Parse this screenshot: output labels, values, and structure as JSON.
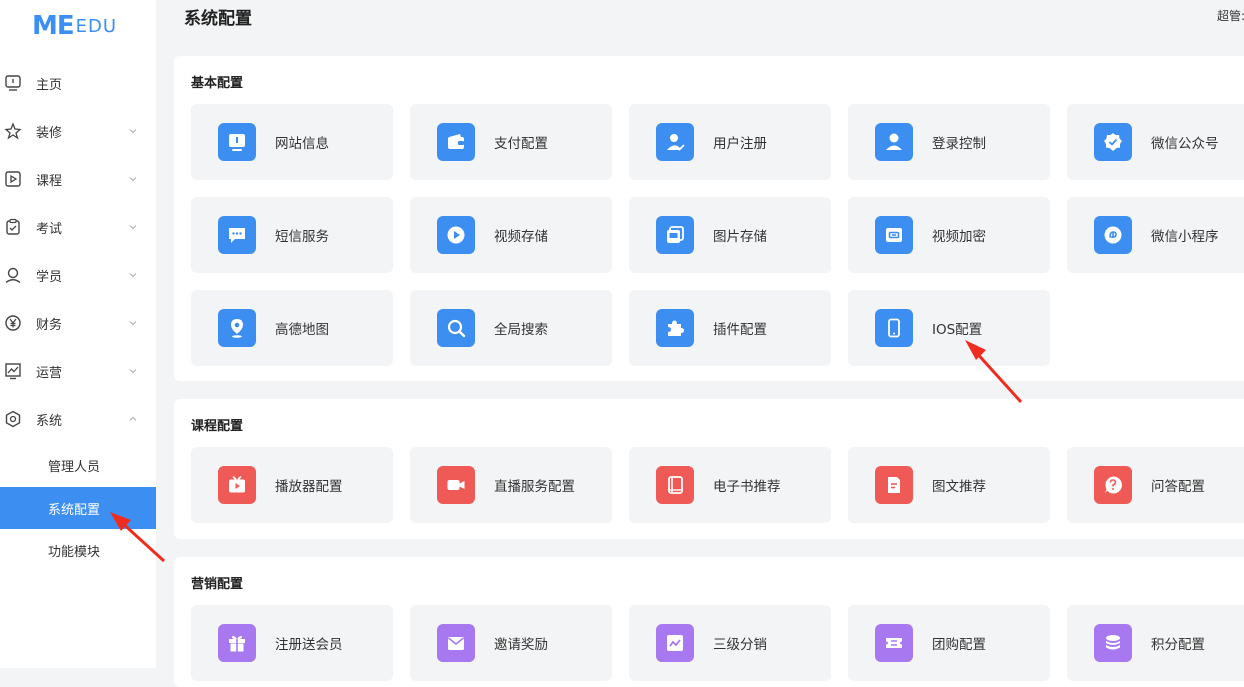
{
  "brand": {
    "logo_main": "ME",
    "logo_sub": "EDU"
  },
  "header": {
    "title": "系统配置",
    "user": "超管:"
  },
  "sidebar": {
    "items": [
      {
        "label": "主页",
        "icon": "monitor-icon"
      },
      {
        "label": "装修",
        "icon": "decorate-icon"
      },
      {
        "label": "课程",
        "icon": "play-box-icon"
      },
      {
        "label": "考试",
        "icon": "clipboard-check-icon"
      },
      {
        "label": "学员",
        "icon": "user-icon"
      },
      {
        "label": "财务",
        "icon": "yen-circle-icon"
      },
      {
        "label": "运营",
        "icon": "chart-icon"
      },
      {
        "label": "系统",
        "icon": "hexagon-settings-icon"
      }
    ],
    "sub_items": [
      {
        "label": "管理人员"
      },
      {
        "label": "系统配置",
        "active": true
      },
      {
        "label": "功能模块"
      }
    ]
  },
  "sections": [
    {
      "title": "基本配置",
      "cards": [
        {
          "label": "网站信息",
          "icon": "monitor-icon",
          "color": "#3d8ef1"
        },
        {
          "label": "支付配置",
          "icon": "wallet-icon",
          "color": "#3d8ef1"
        },
        {
          "label": "用户注册",
          "icon": "user-check-icon",
          "color": "#3d8ef1"
        },
        {
          "label": "登录控制",
          "icon": "user-icon",
          "color": "#3d8ef1"
        },
        {
          "label": "微信公众号",
          "icon": "verified-badge-icon",
          "color": "#3d8ef1"
        },
        {
          "label": "短信服务",
          "icon": "message-icon",
          "color": "#3d8ef1"
        },
        {
          "label": "视频存储",
          "icon": "play-circle-icon",
          "color": "#3d8ef1"
        },
        {
          "label": "图片存储",
          "icon": "image-icon",
          "color": "#3d8ef1"
        },
        {
          "label": "视频加密",
          "icon": "lock-screen-icon",
          "color": "#3d8ef1"
        },
        {
          "label": "微信小程序",
          "icon": "mini-program-icon",
          "color": "#3d8ef1"
        },
        {
          "label": "高德地图",
          "icon": "map-pin-icon",
          "color": "#3d8ef1"
        },
        {
          "label": "全局搜索",
          "icon": "search-icon",
          "color": "#3d8ef1"
        },
        {
          "label": "插件配置",
          "icon": "puzzle-icon",
          "color": "#3d8ef1"
        },
        {
          "label": "IOS配置",
          "icon": "phone-icon",
          "color": "#3d8ef1"
        }
      ]
    },
    {
      "title": "课程配置",
      "cards": [
        {
          "label": "播放器配置",
          "icon": "tv-play-icon",
          "color": "#f05a56"
        },
        {
          "label": "直播服务配置",
          "icon": "video-camera-icon",
          "color": "#f05a56"
        },
        {
          "label": "电子书推荐",
          "icon": "book-icon",
          "color": "#f05a56"
        },
        {
          "label": "图文推荐",
          "icon": "document-icon",
          "color": "#f05a56"
        },
        {
          "label": "问答配置",
          "icon": "question-icon",
          "color": "#f05a56"
        }
      ]
    },
    {
      "title": "营销配置",
      "cards": [
        {
          "label": "注册送会员",
          "icon": "gift-icon",
          "color": "#a778ef"
        },
        {
          "label": "邀请奖励",
          "icon": "envelope-icon",
          "color": "#a778ef"
        },
        {
          "label": "三级分销",
          "icon": "trend-icon",
          "color": "#a778ef"
        },
        {
          "label": "团购配置",
          "icon": "ticket-icon",
          "color": "#a778ef"
        },
        {
          "label": "积分配置",
          "icon": "coins-icon",
          "color": "#a778ef"
        }
      ]
    }
  ]
}
